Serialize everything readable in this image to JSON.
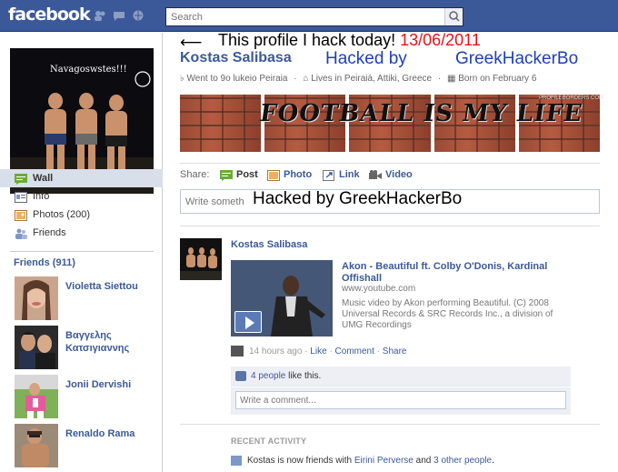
{
  "topbar": {
    "logo": "facebook",
    "search_placeholder": "Search"
  },
  "hack_overlay": {
    "arrow": "⟵",
    "line1": "This profile I hack today!",
    "date": "13/06/2011",
    "hacked_by_1": "Hacked by",
    "hacked_by_2": "GreekHackerBo",
    "composer_overlay": "Hacked by GreekHackerBo"
  },
  "profile": {
    "name": "Kostas Salibasa",
    "pic_caption": "Navagoswstes!!!",
    "education": "Went to 9o lukeio Peiraia",
    "location": "Lives in Peiraiá, Attiki, Greece",
    "birthday": "Born on February 6",
    "banner_text": "FOOTBALL IS MY LIFE",
    "banner_watermark": "PROFILEBORDERS.COM"
  },
  "sidebar": {
    "items": [
      {
        "label": "Wall",
        "icon": "wall-icon"
      },
      {
        "label": "Info",
        "icon": "info-icon"
      },
      {
        "label": "Photos (200)",
        "icon": "photos-icon"
      },
      {
        "label": "Friends",
        "icon": "friends-icon"
      }
    ],
    "friends_header": "Friends (911)",
    "friends": [
      {
        "name": "Violetta Siettou"
      },
      {
        "name": "Βαγγελης Κατσιγιαννης"
      },
      {
        "name": "Jonii Dervishi"
      },
      {
        "name": "Renaldo Rama"
      }
    ]
  },
  "share": {
    "label": "Share:",
    "items": [
      {
        "label": "Post",
        "icon": "post-icon"
      },
      {
        "label": "Photo",
        "icon": "photo-icon"
      },
      {
        "label": "Link",
        "icon": "link-icon"
      },
      {
        "label": "Video",
        "icon": "video-icon"
      }
    ],
    "composer_placeholder": "Write something..."
  },
  "story": {
    "author": "Kostas Salibasa",
    "video_title": "Akon - Beautiful ft. Colby O'Donis, Kardinal Offishall",
    "video_url": "www.youtube.com",
    "video_desc": "Music video by Akon performing Beautiful. (C) 2008 Universal Records & SRC Records Inc., a division of UMG Recordings",
    "time": "14 hours ago",
    "like": "Like",
    "comment": "Comment",
    "share": "Share",
    "likes_count": "4 people",
    "likes_suffix": "like this.",
    "comment_placeholder": "Write a comment..."
  },
  "recent": {
    "header": "RECENT ACTIVITY",
    "text_prefix": "Kostas is now friends with",
    "friend": "Eirini Perverse",
    "mid": "and",
    "others": "3 other people",
    "end": "."
  },
  "colors": {
    "brand": "#3b5998",
    "hack_red": "#e8101a",
    "hack_blue": "#1e3fb8"
  }
}
